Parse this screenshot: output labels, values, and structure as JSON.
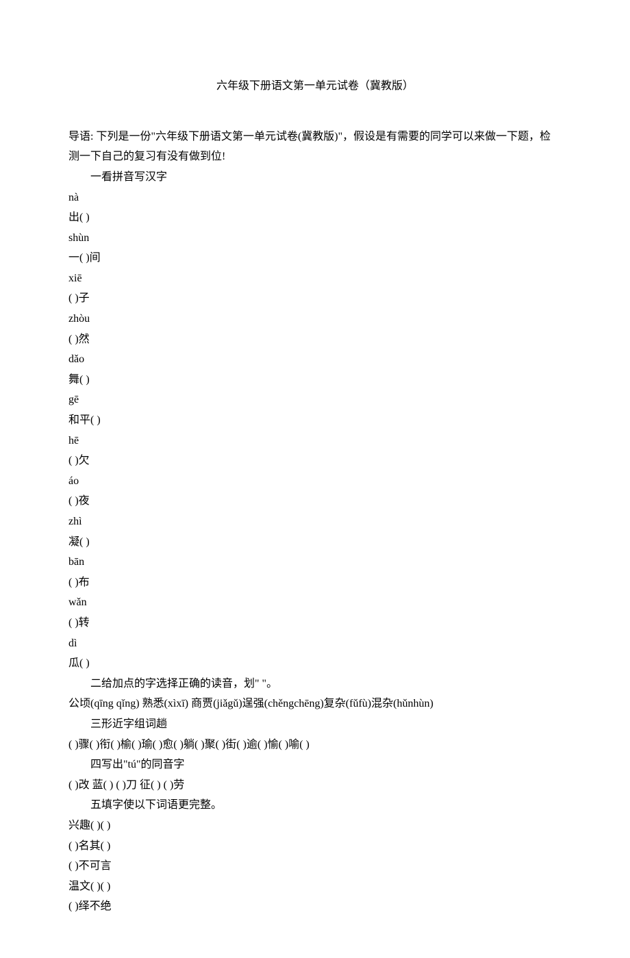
{
  "title": "六年级下册语文第一单元试卷（冀教版）",
  "intro": "导语: 下列是一份\"六年级下册语文第一单元试卷(冀教版)\"，假设是有需要的同学可以来做一下题，检测一下自己的复习有没有做到位!",
  "section1": {
    "heading": "一看拼音写汉字",
    "items": [
      {
        "pinyin": "nà",
        "text": "出( )"
      },
      {
        "pinyin": "shùn",
        "text": "一( )间"
      },
      {
        "pinyin": "xiē",
        "text": "( )子"
      },
      {
        "pinyin": "zhòu",
        "text": "( )然"
      },
      {
        "pinyin": "dǎo",
        "text": "舞( )"
      },
      {
        "pinyin": "gē",
        "text": "和平( )"
      },
      {
        "pinyin": "hē",
        "text": "( )欠"
      },
      {
        "pinyin": "áo",
        "text": "( )夜"
      },
      {
        "pinyin": "zhì",
        "text": "凝( )"
      },
      {
        "pinyin": "bān",
        "text": "( )布"
      },
      {
        "pinyin": "wǎn",
        "text": "( )转"
      },
      {
        "pinyin": "dì",
        "text": "瓜( )"
      }
    ]
  },
  "section2": {
    "heading": "二给加点的字选择正确的读音，划\"  \"。",
    "line": "公顷(qīng qǐng)  熟悉(xìxī)  商贾(jiǎgǔ)逞强(chěngchēng)复杂(fǔfù)混杂(hǔnhùn)"
  },
  "section3": {
    "heading": "三形近字组词趟",
    "line": "( )骤( )衔( )榆( )瑜( )愈( )躺( )聚( )街( )逾( )愉( )喻( )"
  },
  "section4": {
    "heading": "四写出\"tú\"的同音字",
    "line": "( )改  蓝( ) ( )刀  征( ) ( )劳"
  },
  "section5": {
    "heading": "五填字使以下词语更完整。",
    "items": [
      "兴趣( )( )",
      "( )名其( )",
      "( )不可言",
      "温文( )( )",
      "( )绎不绝"
    ]
  }
}
